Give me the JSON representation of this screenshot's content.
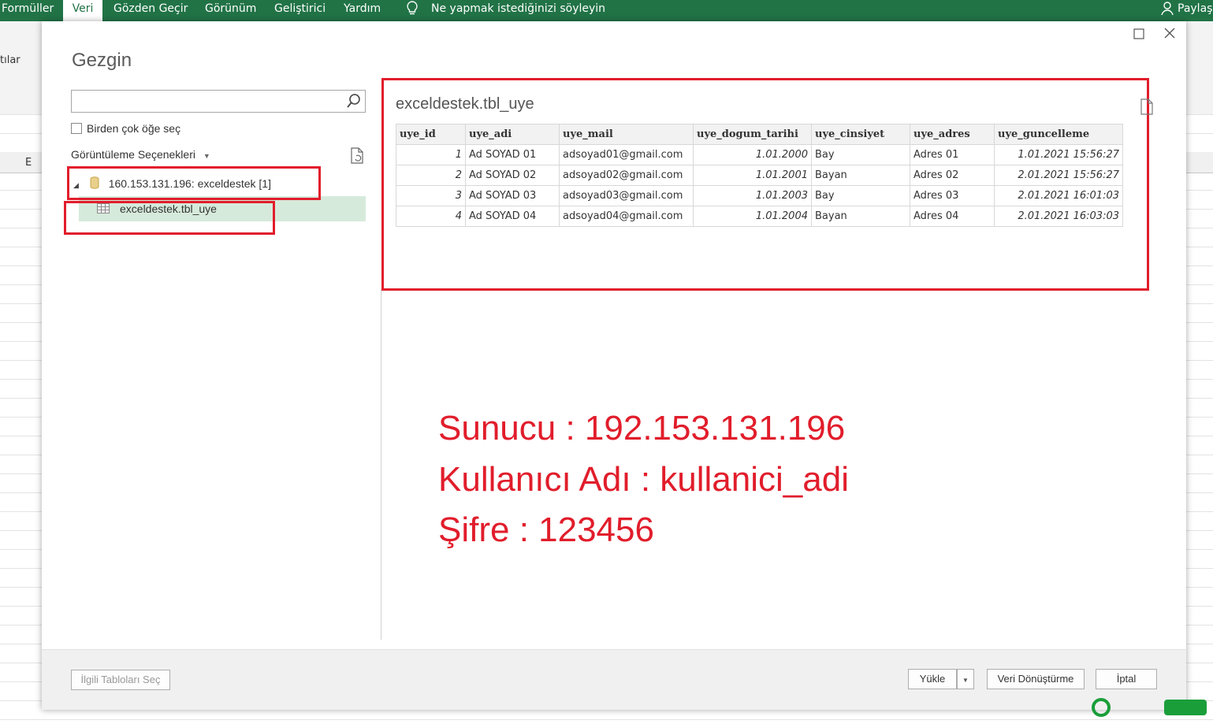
{
  "ribbon": {
    "tabs": [
      "Formüller",
      "Veri",
      "Gözden Geçir",
      "Görünüm",
      "Geliştirici",
      "Yardım"
    ],
    "active_tab": "Veri",
    "tell_me": "Ne yapmak istediğinizi söyleyin",
    "share": "Paylaş",
    "left_fragment": "tılar",
    "column_label": "E"
  },
  "dialog": {
    "title": "Gezgin",
    "search_placeholder": "",
    "multi_select_label": "Birden çok öğe seç",
    "view_options_label": "Görüntüleme Seçenekleri",
    "tree": {
      "server_node": "160.153.131.196: exceldestek [1]",
      "table_node": "exceldestek.tbl_uye"
    },
    "preview": {
      "title": "exceldestek.tbl_uye",
      "columns": [
        "uye_id",
        "uye_adi",
        "uye_mail",
        "uye_dogum_tarihi",
        "uye_cinsiyet",
        "uye_adres",
        "uye_guncelleme"
      ],
      "rows": [
        [
          "1",
          "Ad SOYAD 01",
          "adsoyad01@gmail.com",
          "1.01.2000",
          "Bay",
          "Adres 01",
          "1.01.2021 15:56:27"
        ],
        [
          "2",
          "Ad SOYAD 02",
          "adsoyad02@gmail.com",
          "1.01.2001",
          "Bayan",
          "Adres 02",
          "2.01.2021 15:56:27"
        ],
        [
          "3",
          "Ad SOYAD 03",
          "adsoyad03@gmail.com",
          "1.01.2003",
          "Bay",
          "Adres 03",
          "2.01.2021 16:01:03"
        ],
        [
          "4",
          "Ad SOYAD 04",
          "adsoyad04@gmail.com",
          "1.01.2004",
          "Bayan",
          "Adres 04",
          "2.01.2021 16:03:03"
        ]
      ]
    },
    "annotation": {
      "line1": "Sunucu : 192.153.131.196",
      "line2": "Kullanıcı Adı : kullanici_adi",
      "line3": "Şifre : 123456"
    },
    "buttons": {
      "related_tables": "İlgili Tabloları Seç",
      "load": "Yükle",
      "transform": "Veri Dönüştürme",
      "cancel": "İptal"
    }
  },
  "colors": {
    "ribbon_green": "#217346",
    "annotation_red": "#e11d2b",
    "selected_row": "#d6eadb"
  }
}
